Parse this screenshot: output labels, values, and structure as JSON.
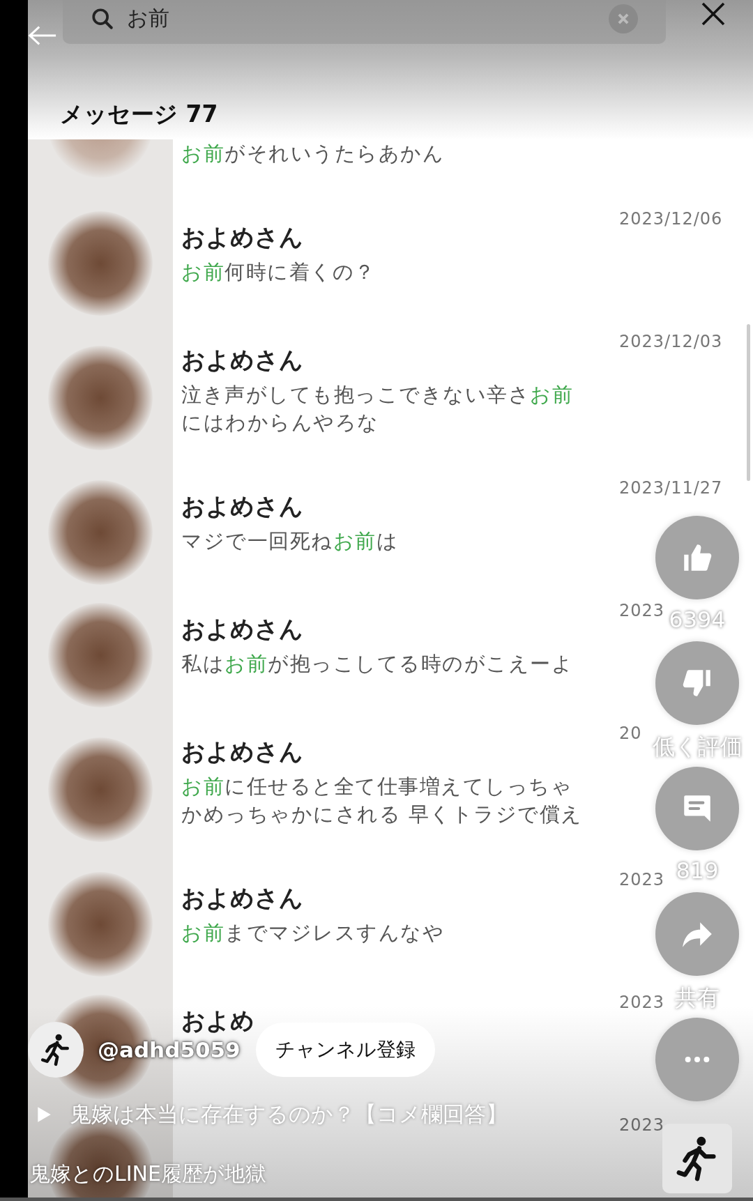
{
  "search": {
    "value": "お前"
  },
  "section_title": "メッセージ 77",
  "messages": [
    {
      "text": [
        {
          "text": "お前",
          "highlight": true
        },
        {
          "text": "がそれいうたらあかん",
          "highlight": false
        }
      ]
    },
    {
      "name": "およめさん",
      "date": "2023/12/06",
      "text": [
        {
          "text": "お前",
          "highlight": true
        },
        {
          "text": "何時に着くの？",
          "highlight": false
        }
      ]
    },
    {
      "name": "およめさん",
      "date": "2023/12/03",
      "text": [
        {
          "text": "泣き声がしても抱っこできない辛さ",
          "highlight": false
        },
        {
          "text": "お前",
          "highlight": true
        },
        {
          "text": "にはわからんやろな",
          "highlight": false
        }
      ]
    },
    {
      "name": "およめさん",
      "date": "2023/11/27",
      "text": [
        {
          "text": "マジで一回死ね",
          "highlight": false
        },
        {
          "text": "お前",
          "highlight": true
        },
        {
          "text": "は",
          "highlight": false
        }
      ]
    },
    {
      "name": "およめさん",
      "date": "2023",
      "text": [
        {
          "text": "私は",
          "highlight": false
        },
        {
          "text": "お前",
          "highlight": true
        },
        {
          "text": "が抱っこしてる時のがこえーよ",
          "highlight": false
        }
      ]
    },
    {
      "name": "およめさん",
      "date": "20",
      "text": [
        {
          "text": "お前",
          "highlight": true
        },
        {
          "text": "に任せると全て仕事増えてしっちゃかめっちゃかにされる 早くトラジで償え",
          "highlight": false
        }
      ]
    },
    {
      "name": "およめさん",
      "date": "2023",
      "text": [
        {
          "text": "お前",
          "highlight": true
        },
        {
          "text": "までマジレスすんなや",
          "highlight": false
        }
      ]
    },
    {
      "name": "およめ",
      "date": "2023"
    },
    {
      "date": "2023"
    }
  ],
  "actions": [
    {
      "kind": "like",
      "label": "6394"
    },
    {
      "kind": "dislike",
      "label": "低く評価"
    },
    {
      "kind": "comment",
      "label": "819"
    },
    {
      "kind": "share",
      "label": "共有"
    },
    {
      "kind": "more"
    }
  ],
  "channel": {
    "handle": "@adhd5059",
    "subscribe": "チャンネル登録"
  },
  "video_title": "鬼嫁は本当に存在するのか？【コメ欄回答】",
  "caption": "鬼嫁とのLINE履歴が地獄"
}
